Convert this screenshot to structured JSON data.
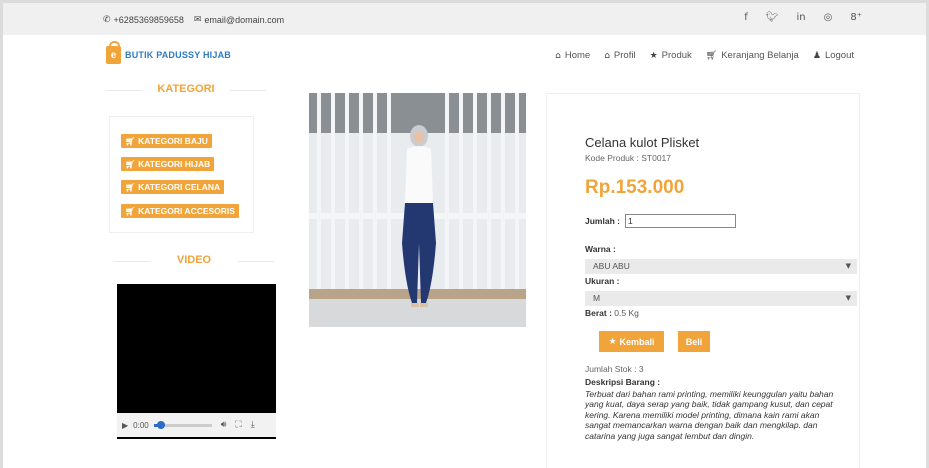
{
  "topbar": {
    "phone": "+6285369859658",
    "email": "email@domain.com",
    "social": [
      "f",
      "❧",
      "in",
      "◎",
      "8⁺"
    ]
  },
  "brand": {
    "name": "BUTIK PADUSSY HIJAB",
    "logo_letter": "e"
  },
  "nav": [
    {
      "icon": "home-icon",
      "label": "Home"
    },
    {
      "icon": "profile-icon",
      "label": "Profil"
    },
    {
      "icon": "star-icon",
      "label": "Produk"
    },
    {
      "icon": "cart-icon",
      "label": "Keranjang Belanja"
    },
    {
      "icon": "user-icon",
      "label": "Logout"
    }
  ],
  "sidebar": {
    "kategori_title": "KATEGORI",
    "categories": [
      "KATEGORI BAJU",
      "KATEGORI HIJAB",
      "KATEGORI CELANA",
      "KATEGORI ACCESORIS"
    ],
    "video_title": "VIDEO",
    "video_time": "0:00",
    "video_progress": 0.12
  },
  "product": {
    "name": "Celana kulot Plisket",
    "kode_label": "Kode Produk : ",
    "kode": "ST0017",
    "price": "Rp.153.000",
    "jumlah_label": "Jumlah :",
    "jumlah_value": "1",
    "warna_label": "Warna :",
    "warna_value": "ABU ABU",
    "ukuran_label": "Ukuran :",
    "ukuran_value": "M",
    "berat_label": "Berat :",
    "berat_value": " 0.5 Kg",
    "kembali_label": "Kembali",
    "beli_label": "Beli",
    "stok": "Jumlah Stok : 3",
    "deskripsi_label": "Deskripsi Barang :",
    "deskripsi": "Terbuat dari bahan rami printing, memiliki keunggulan yaitu bahan yang kuat, daya serap yang baik, tidak gampang kusut, dan cepat kering. Karena memiliki model printing, dimana kain rami akan sangat memancarkan warna dengan baik dan mengkilap. dan catarina yang juga sangat lembut dan dingin."
  },
  "colors": {
    "accent": "#f0a43a",
    "brand_blue": "#2d7bc2"
  }
}
